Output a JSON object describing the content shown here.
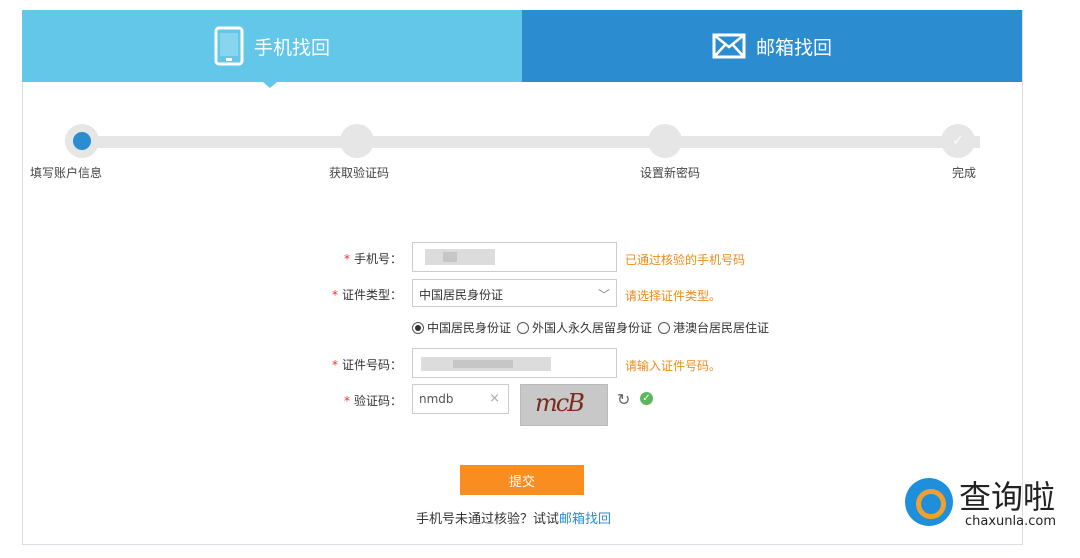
{
  "tabs": {
    "phone_label": "手机找回",
    "mail_label": "邮箱找回"
  },
  "steps": [
    {
      "label": "填写账户信息"
    },
    {
      "label": "获取验证码"
    },
    {
      "label": "设置新密码"
    },
    {
      "label": "完成"
    }
  ],
  "form": {
    "phone": {
      "label": "手机号：",
      "hint": "已通过核验的手机号码"
    },
    "id_type": {
      "label": "证件类型：",
      "value": "中国居民身份证",
      "hint": "请选择证件类型。"
    },
    "radio_options": [
      "中国居民身份证",
      "外国人永久居留身份证",
      "港澳台居民居住证"
    ],
    "id_number": {
      "label": "证件号码：",
      "hint": "请输入证件号码。"
    },
    "captcha": {
      "label": "验证码：",
      "value": "nmdb",
      "image_text": "mcB"
    },
    "submit_label": "提交"
  },
  "bottom": {
    "text": "手机号未通过核验？试试",
    "link": "邮箱找回"
  },
  "watermark": {
    "title": "查询啦",
    "url": "chaxunla.com"
  },
  "colors": {
    "phone_tab": "#62c7e8",
    "mail_tab": "#2b8ccf",
    "hint": "#f08a1c",
    "submit": "#f98d1f"
  }
}
